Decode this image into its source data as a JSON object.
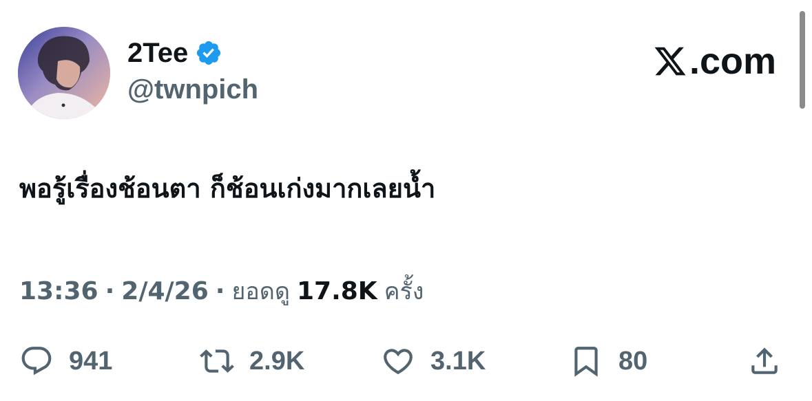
{
  "author": {
    "display_name": "2Tee",
    "handle": "@twnpich",
    "verified": true
  },
  "brand": {
    "text": ".com",
    "icon": "x-logo-icon"
  },
  "tweet": {
    "text": "พอรู้เรื่องช้อนตา ก็ช้อนเก่งมากเลยน้ำ"
  },
  "meta": {
    "time": "13:36",
    "sep1": "·",
    "date": "2/4/26",
    "sep2": "·",
    "views_label": "ยอดดู",
    "views_count": "17.8K",
    "views_unit": "ครั้ง"
  },
  "actions": {
    "reply": {
      "count": "941",
      "icon": "reply-icon"
    },
    "retweet": {
      "count": "2.9K",
      "icon": "retweet-icon"
    },
    "like": {
      "count": "3.1K",
      "icon": "heart-icon"
    },
    "bookmark": {
      "count": "80",
      "icon": "bookmark-icon"
    },
    "share": {
      "icon": "share-icon"
    }
  },
  "colors": {
    "text_primary": "#0f1419",
    "text_secondary": "#536471",
    "verified_blue": "#1d9bf0"
  }
}
